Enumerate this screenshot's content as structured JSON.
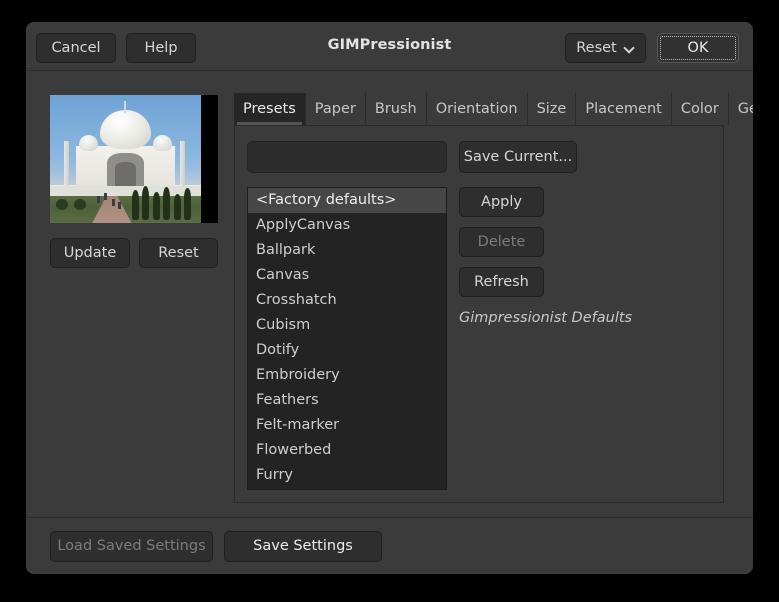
{
  "window": {
    "title": "GIMPressionist"
  },
  "header": {
    "cancel_label": "Cancel",
    "help_label": "Help",
    "reset_label": "Reset",
    "ok_label": "OK"
  },
  "preview": {
    "image_alt": "Taj Mahal photograph preview",
    "update_label": "Update",
    "reset_label": "Reset"
  },
  "tabs": [
    {
      "label": "Presets",
      "active": true
    },
    {
      "label": "Paper",
      "active": false
    },
    {
      "label": "Brush",
      "active": false
    },
    {
      "label": "Orientation",
      "active": false
    },
    {
      "label": "Size",
      "active": false
    },
    {
      "label": "Placement",
      "active": false
    },
    {
      "label": "Color",
      "active": false
    },
    {
      "label": "General",
      "active": false
    }
  ],
  "presets_panel": {
    "name_entry_value": "",
    "name_entry_placeholder": "",
    "save_current_label": "Save Current...",
    "apply_label": "Apply",
    "delete_label": "Delete",
    "delete_disabled": true,
    "refresh_label": "Refresh",
    "description": "Gimpressionist Defaults",
    "presets": [
      {
        "label": "<Factory defaults>",
        "selected": true
      },
      {
        "label": "ApplyCanvas",
        "selected": false
      },
      {
        "label": "Ballpark",
        "selected": false
      },
      {
        "label": "Canvas",
        "selected": false
      },
      {
        "label": "Crosshatch",
        "selected": false
      },
      {
        "label": "Cubism",
        "selected": false
      },
      {
        "label": "Dotify",
        "selected": false
      },
      {
        "label": "Embroidery",
        "selected": false
      },
      {
        "label": "Feathers",
        "selected": false
      },
      {
        "label": "Felt-marker",
        "selected": false
      },
      {
        "label": "Flowerbed",
        "selected": false
      },
      {
        "label": "Furry",
        "selected": false
      }
    ]
  },
  "footer": {
    "load_saved_label": "Load Saved Settings",
    "load_saved_disabled": true,
    "save_settings_label": "Save Settings"
  },
  "colors": {
    "window_bg": "#3b3b3b",
    "button_bg": "#2e2e2e",
    "list_bg": "#232323",
    "selection_bg": "#464646",
    "text": "#d6d6d6",
    "disabled_text": "#7c7c7c",
    "desktop_bg": "#000000"
  }
}
